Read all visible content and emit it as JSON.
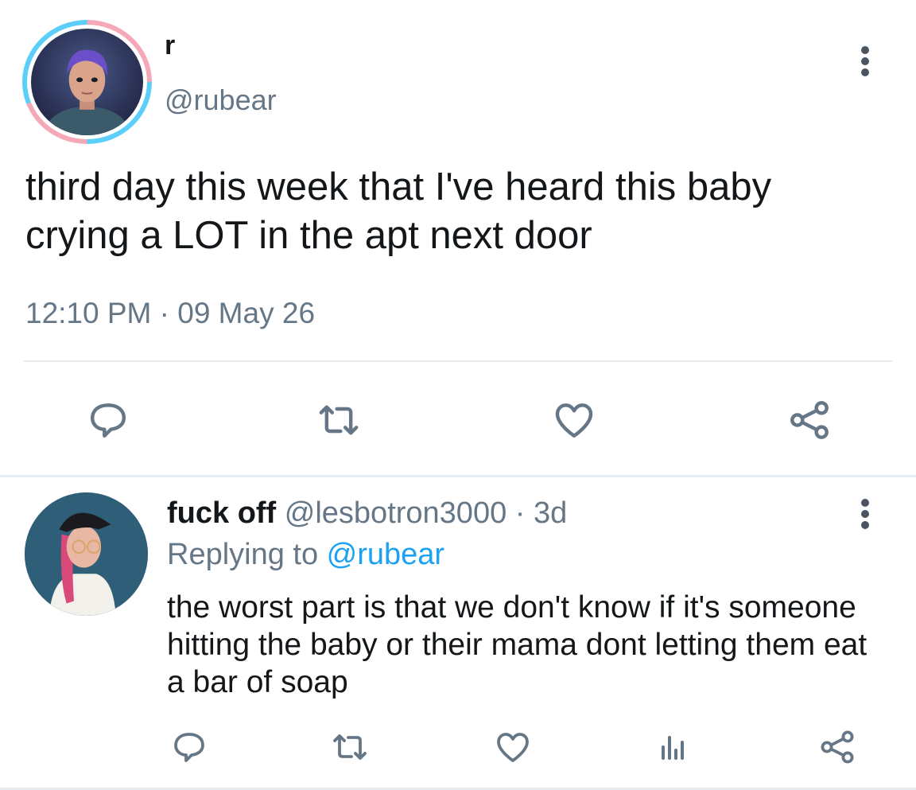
{
  "main_tweet": {
    "display_name": "r",
    "handle": "@rubear",
    "text": "third day this week that I've heard this baby crying a LOT in the apt next door",
    "timestamp": "12:10 PM · 09 May 26",
    "actions": [
      "reply-icon",
      "retweet-icon",
      "like-icon",
      "share-icon"
    ]
  },
  "reply": {
    "display_name": "fuck off",
    "meta": " @lesbotron3000 · 3d",
    "replying_prefix": "Replying to ",
    "replying_to": "@rubear",
    "text": "the worst part is that we don't know if it's someone hitting the baby or their mama dont letting them eat a bar of soap",
    "actions": [
      "reply-icon",
      "retweet-icon",
      "like-icon",
      "analytics-icon",
      "share-icon"
    ]
  },
  "colors": {
    "text": "#14171a",
    "secondary": "#657786",
    "accent": "#1da1f2",
    "divider": "#e6ecf0",
    "icon": "#657786"
  }
}
